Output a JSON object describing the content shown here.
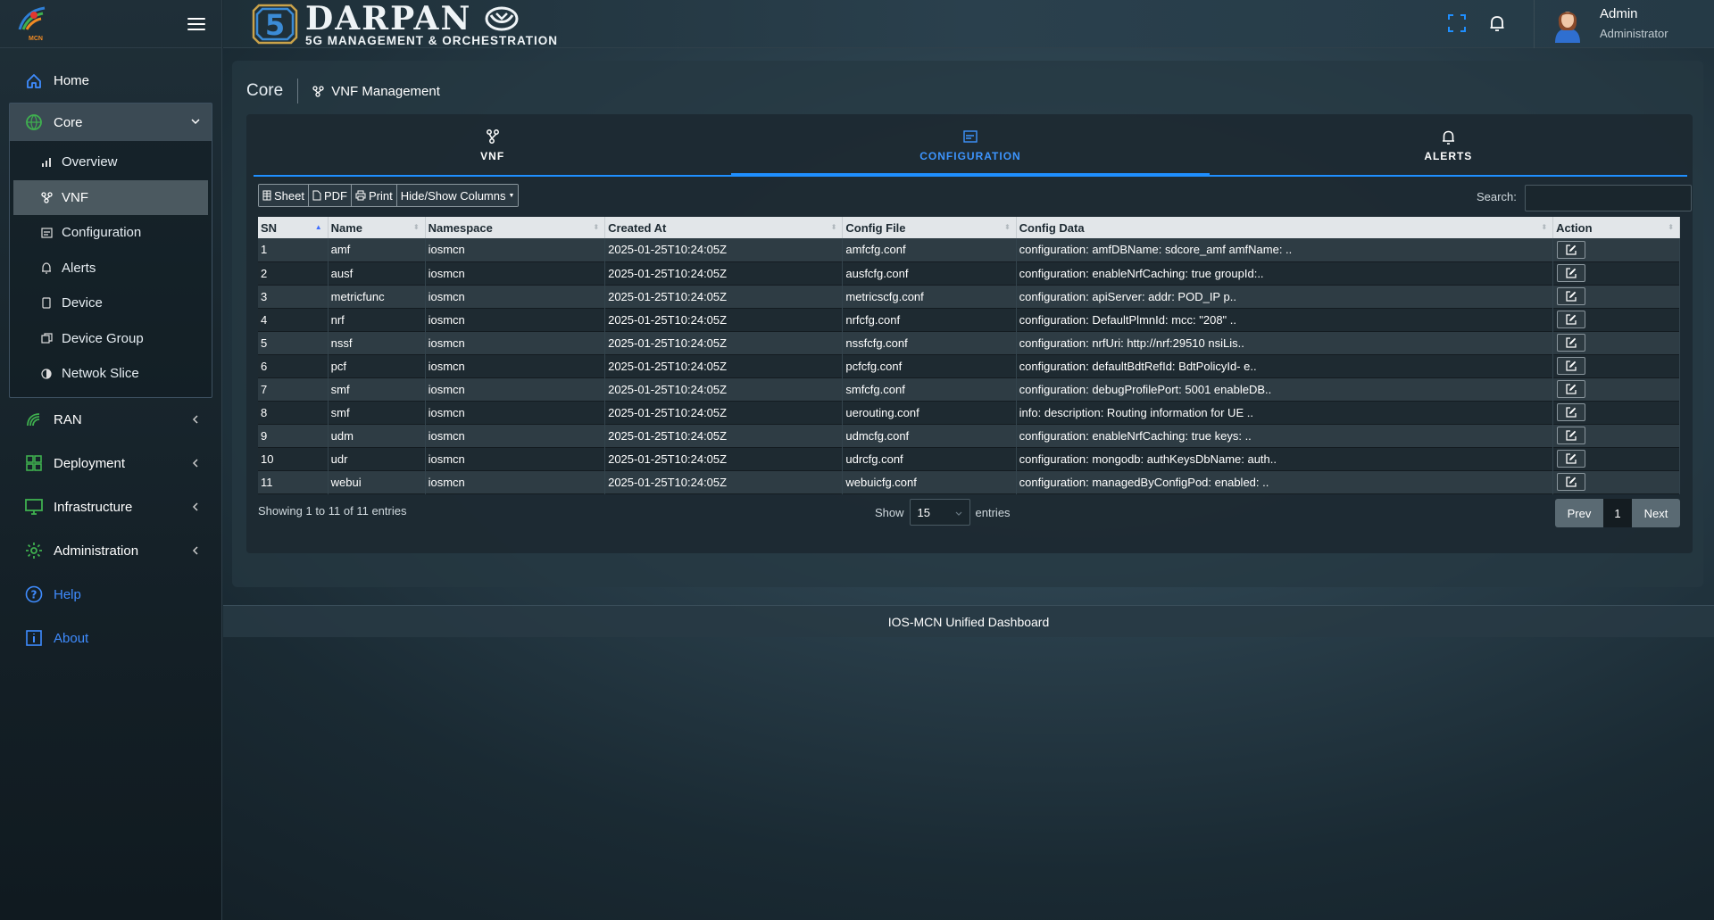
{
  "sidebar": {
    "logo_text": "MCN",
    "items": [
      {
        "label": "Home",
        "icon": "home-icon"
      },
      {
        "label": "Core",
        "icon": "core-icon"
      },
      {
        "label": "RAN",
        "icon": "ran-icon"
      },
      {
        "label": "Deployment",
        "icon": "grid-icon"
      },
      {
        "label": "Infrastructure",
        "icon": "monitor-icon"
      },
      {
        "label": "Administration",
        "icon": "gear-icon"
      },
      {
        "label": "Help",
        "icon": "help-icon"
      },
      {
        "label": "About",
        "icon": "info-icon"
      }
    ],
    "core_sub": [
      {
        "label": "Overview",
        "icon": "chart-icon"
      },
      {
        "label": "VNF",
        "icon": "vnf-icon",
        "active": true
      },
      {
        "label": "Configuration",
        "icon": "config-icon"
      },
      {
        "label": "Alerts",
        "icon": "bell-icon"
      },
      {
        "label": "Device",
        "icon": "device-icon"
      },
      {
        "label": "Device Group",
        "icon": "device-group-icon"
      },
      {
        "label": "Netwok Slice",
        "icon": "slice-icon"
      }
    ]
  },
  "topbar": {
    "brand_name": "DARPAN",
    "brand_sub": "5G MANAGEMENT & ORCHESTRATION",
    "user_name": "Admin",
    "user_role": "Administrator"
  },
  "breadcrumb": {
    "section": "Core",
    "page": "VNF Management"
  },
  "tabs": [
    {
      "label": "VNF",
      "icon": "vnf-icon"
    },
    {
      "label": "CONFIGURATION",
      "icon": "config-icon",
      "active": true
    },
    {
      "label": "ALERTS",
      "icon": "bell-icon"
    }
  ],
  "toolbar": {
    "sheet": "Sheet",
    "pdf": "PDF",
    "print": "Print",
    "columns": "Hide/Show Columns"
  },
  "search": {
    "label": "Search:",
    "value": ""
  },
  "table": {
    "columns": [
      "SN",
      "Name",
      "Namespace",
      "Created At",
      "Config File",
      "Config Data",
      "Action"
    ],
    "rows": [
      [
        "1",
        "amf",
        "iosmcn",
        "2025-01-25T10:24:05Z",
        "amfcfg.conf",
        "configuration: amfDBName: sdcore_amf amfName: .."
      ],
      [
        "2",
        "ausf",
        "iosmcn",
        "2025-01-25T10:24:05Z",
        "ausfcfg.conf",
        "configuration: enableNrfCaching: true groupId:.."
      ],
      [
        "3",
        "metricfunc",
        "iosmcn",
        "2025-01-25T10:24:05Z",
        "metricscfg.conf",
        "configuration: apiServer: addr: POD_IP p.."
      ],
      [
        "4",
        "nrf",
        "iosmcn",
        "2025-01-25T10:24:05Z",
        "nrfcfg.conf",
        "configuration: DefaultPlmnId: mcc: \"208\" .."
      ],
      [
        "5",
        "nssf",
        "iosmcn",
        "2025-01-25T10:24:05Z",
        "nssfcfg.conf",
        "configuration: nrfUri: http://nrf:29510 nsiLis.."
      ],
      [
        "6",
        "pcf",
        "iosmcn",
        "2025-01-25T10:24:05Z",
        "pcfcfg.conf",
        "configuration: defaultBdtRefId: BdtPolicyId- e.."
      ],
      [
        "7",
        "smf",
        "iosmcn",
        "2025-01-25T10:24:05Z",
        "smfcfg.conf",
        "configuration: debugProfilePort: 5001 enableDB.."
      ],
      [
        "8",
        "smf",
        "iosmcn",
        "2025-01-25T10:24:05Z",
        "uerouting.conf",
        "info: description: Routing information for UE .."
      ],
      [
        "9",
        "udm",
        "iosmcn",
        "2025-01-25T10:24:05Z",
        "udmcfg.conf",
        "configuration: enableNrfCaching: true keys: .."
      ],
      [
        "10",
        "udr",
        "iosmcn",
        "2025-01-25T10:24:05Z",
        "udrcfg.conf",
        "configuration: mongodb: authKeysDbName: auth.."
      ],
      [
        "11",
        "webui",
        "iosmcn",
        "2025-01-25T10:24:05Z",
        "webuicfg.conf",
        "configuration: managedByConfigPod: enabled: .."
      ]
    ]
  },
  "footer_info": {
    "showing": "Showing 1 to 11 of 11 entries",
    "show_label": "Show",
    "page_length": "15",
    "entries_label": "entries",
    "prev": "Prev",
    "page": "1",
    "next": "Next"
  },
  "footer": "IOS-MCN Unified Dashboard",
  "colors": {
    "accent": "#1f8fff",
    "link": "#3f8cff",
    "brand_orange": "#f08a24"
  }
}
